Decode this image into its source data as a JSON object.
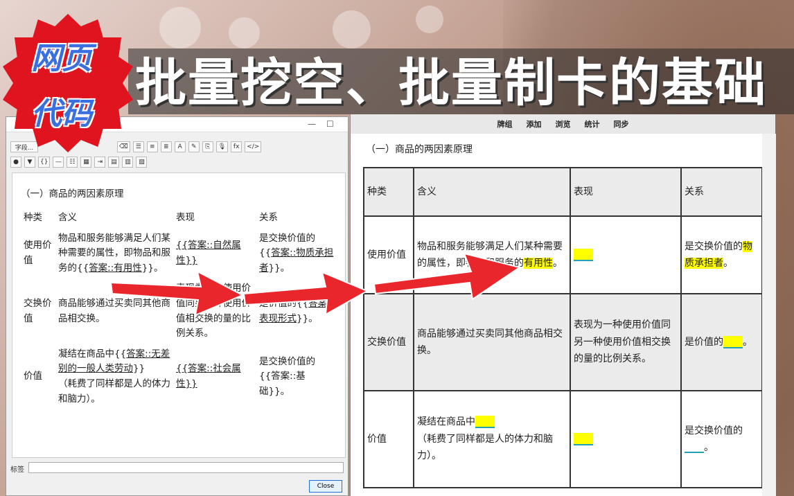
{
  "banner": {
    "title": "批量挖空、批量制卡的基础",
    "badge_line1": "网页",
    "badge_line2": "代码"
  },
  "editor": {
    "field_select": "字段...",
    "tag_label": "标签",
    "close_label": "Close",
    "heading": "（一）商品的两因素原理",
    "table": {
      "headers": [
        "种类",
        "含义",
        "表现",
        "关系"
      ],
      "rows": [
        {
          "kind": "使用价值",
          "meaning_pre": "物品和服务能够满足人们某种需要的属性，即物品和服务的{{",
          "meaning_cloze": "答案::有用性",
          "meaning_post": "}}。",
          "show": "{{答案::自然属性}}",
          "relation_pre": "是交换价值的{{",
          "relation_cloze": "答案::物质承担者",
          "relation_post": "}}。"
        },
        {
          "kind": "交换价值",
          "meaning": "商品能够通过买卖同其他商品相交换。",
          "show": "表现为一种使用价值同另一种使用价值相交换的量的比例关系。",
          "relation_pre": "是价值的{{",
          "relation_cloze": "答案::表现形式",
          "relation_post": "}}。"
        },
        {
          "kind": "价值",
          "meaning_pre": "凝结在商品中{{",
          "meaning_cloze": "答案::无差别的一般人类劳动",
          "meaning_post": "}}",
          "meaning_note": "（耗费了同样都是人的体力和脑力）。",
          "show": "{{答案::社会属性}}",
          "relation": "是交换价值的{{答案::基础}}。"
        }
      ]
    }
  },
  "card": {
    "toolbar": [
      "牌组",
      "添加",
      "浏览",
      "统计",
      "同步"
    ],
    "heading": "（一）商品的两因素原理",
    "headers": [
      "种类",
      "含义",
      "表现",
      "关系"
    ],
    "rows": [
      {
        "kind": "使用价值",
        "meaning_pre": "物品和服务能够满足人们某种需要的属性，即物品和服务的",
        "meaning_hl": "有用性",
        "meaning_post": "。",
        "relation_pre": "是交换价值的",
        "relation_hl": "物质承担者",
        "relation_post": "。"
      },
      {
        "kind": "交换价值",
        "meaning": "商品能够通过买卖同其他商品相交换。",
        "show": "表现为一种使用价值同另一种使用价值相交换的量的比例关系。",
        "relation_pre": "是价值的",
        "relation_post": "。"
      },
      {
        "kind": "价值",
        "meaning_pre": "凝结在商品中",
        "meaning_note": "（耗费了同样都是人的体力和脑力）。",
        "relation_pre": "是交换价值的",
        "relation_post": "。"
      }
    ]
  },
  "colors": {
    "highlight": "#ffff00",
    "arrow": "#e8262b",
    "badge": "#e0141e",
    "badge_text": "#3a6fe0"
  }
}
